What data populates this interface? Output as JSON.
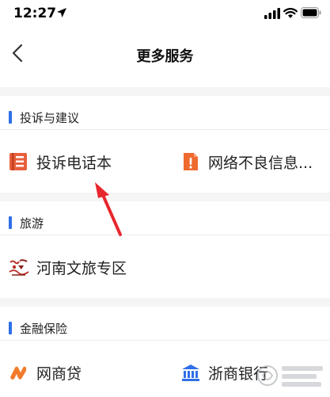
{
  "status": {
    "time": "12:27"
  },
  "nav": {
    "title": "更多服务"
  },
  "sections": [
    {
      "title": "投诉与建议",
      "items": [
        {
          "label": "投诉电话本",
          "icon": "phonebook-icon",
          "color": "#e8603c"
        },
        {
          "label": "网络不良信息...",
          "icon": "report-document-icon",
          "color": "#ee6a2f"
        }
      ]
    },
    {
      "title": "旅游",
      "items": [
        {
          "label": "河南文旅专区",
          "icon": "henan-culture-logo",
          "color": "#b8322a"
        }
      ]
    },
    {
      "title": "金融保险",
      "items": [
        {
          "label": "网商贷",
          "icon": "wangshang-loan-icon",
          "color": "#f07b2b"
        },
        {
          "label": "浙商银行",
          "icon": "bank-icon",
          "color": "#2f6fe8"
        }
      ]
    }
  ],
  "colors": {
    "accent": "#2f6fe8",
    "annotation_arrow": "#e8262e",
    "background": "#f5f5f5"
  }
}
